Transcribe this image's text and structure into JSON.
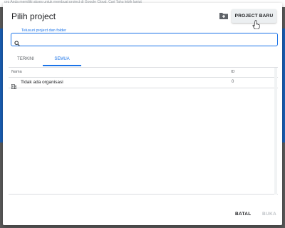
{
  "background": {
    "top_text": "org Anda memiliki akses untuk membuat project di Google Cloud, Cari Tahu lebih lanjut",
    "accent_color": "#1a5fb4"
  },
  "dialog": {
    "title": "Pilih project",
    "new_project_label": "PROJECT BARU",
    "icons": {
      "folder": "folder-add-icon",
      "cursor": "hand-pointer-icon",
      "search": "search-icon",
      "organization": "organization-building-icon"
    }
  },
  "search": {
    "label": "Telusuri project dan folder",
    "value": "",
    "accent_color": "#1a73e8"
  },
  "tabs": [
    {
      "label": "TERKINI",
      "active": false
    },
    {
      "label": "SEMUA",
      "active": true
    }
  ],
  "table": {
    "columns": [
      "Nama",
      "ID"
    ],
    "rows": [
      {
        "name": "Tidak ada organisasi",
        "id": "0"
      }
    ]
  },
  "actions": {
    "cancel": "BATAL",
    "open": "BUKA"
  }
}
